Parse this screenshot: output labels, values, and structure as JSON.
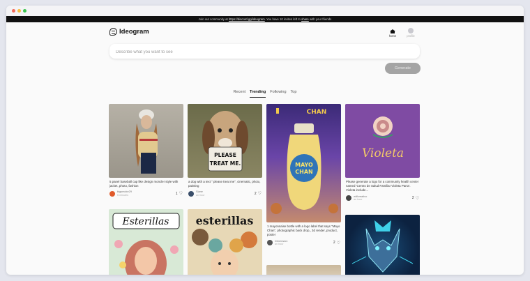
{
  "banner": {
    "prefix": "Join our community at",
    "link": "https://discord.gg/ideogram",
    "middle": ". You have 10 invites left to",
    "share": "share",
    "suffix": "with your friends"
  },
  "header": {
    "logo_text": "Ideogram",
    "nav": [
      {
        "label": "home",
        "icon": "home-icon"
      },
      {
        "label": "profile",
        "icon": "profile-icon"
      }
    ]
  },
  "search": {
    "placeholder": "Describe what you want to see",
    "value": ""
  },
  "generate_label": "Generate",
  "tabs": [
    {
      "label": "Recent",
      "active": false
    },
    {
      "label": "Trending",
      "active": true
    },
    {
      "label": "Following",
      "active": false
    },
    {
      "label": "Top",
      "active": false
    }
  ],
  "cards": [
    {
      "desc": "5 panel baseball cap like design moncler style with jacket, photo, fashion",
      "user": "bigsmoke29",
      "sub": "5 minutes",
      "likes": "1",
      "image_text": "",
      "avatar_color": "#e05a2b"
    },
    {
      "desc": "a dog with a text \" please treat me\", cinematic, photo, painting",
      "user": "Siane",
      "sub": "an hour",
      "likes": "2",
      "image_text": "PLEASE TREAT ME.",
      "avatar_color": "#3a4e6a"
    },
    {
      "desc": "1 mayonnaise bottle with a logo label that says \"Mayo Chan\", photographic back drop,, 3d render, product, poster",
      "user": "Dimension",
      "sub": "an hour",
      "likes": "2",
      "image_text": "MAYO CHAN",
      "header_text": "CHAN",
      "avatar_color": "#555"
    },
    {
      "desc": "Please generate a logo for a community health center named 'Centro de Salud Familiar Violeta Parra'. Violeta include...",
      "user": "wilfcreativo",
      "sub": "an hour",
      "likes": "2",
      "image_text": "Violeta",
      "avatar_color": "#444"
    },
    {
      "desc": "",
      "user": "",
      "sub": "",
      "likes": "",
      "image_text": "Esterillas",
      "avatar_color": "#888"
    },
    {
      "desc": "",
      "user": "",
      "sub": "",
      "likes": "",
      "image_text": "esterillas",
      "avatar_color": "#888"
    },
    {
      "desc": "",
      "user": "",
      "sub": "",
      "likes": "",
      "image_text": "",
      "avatar_color": "#888"
    },
    {
      "desc": "",
      "user": "",
      "sub": "",
      "likes": "",
      "image_text": "",
      "avatar_color": "#888"
    }
  ]
}
